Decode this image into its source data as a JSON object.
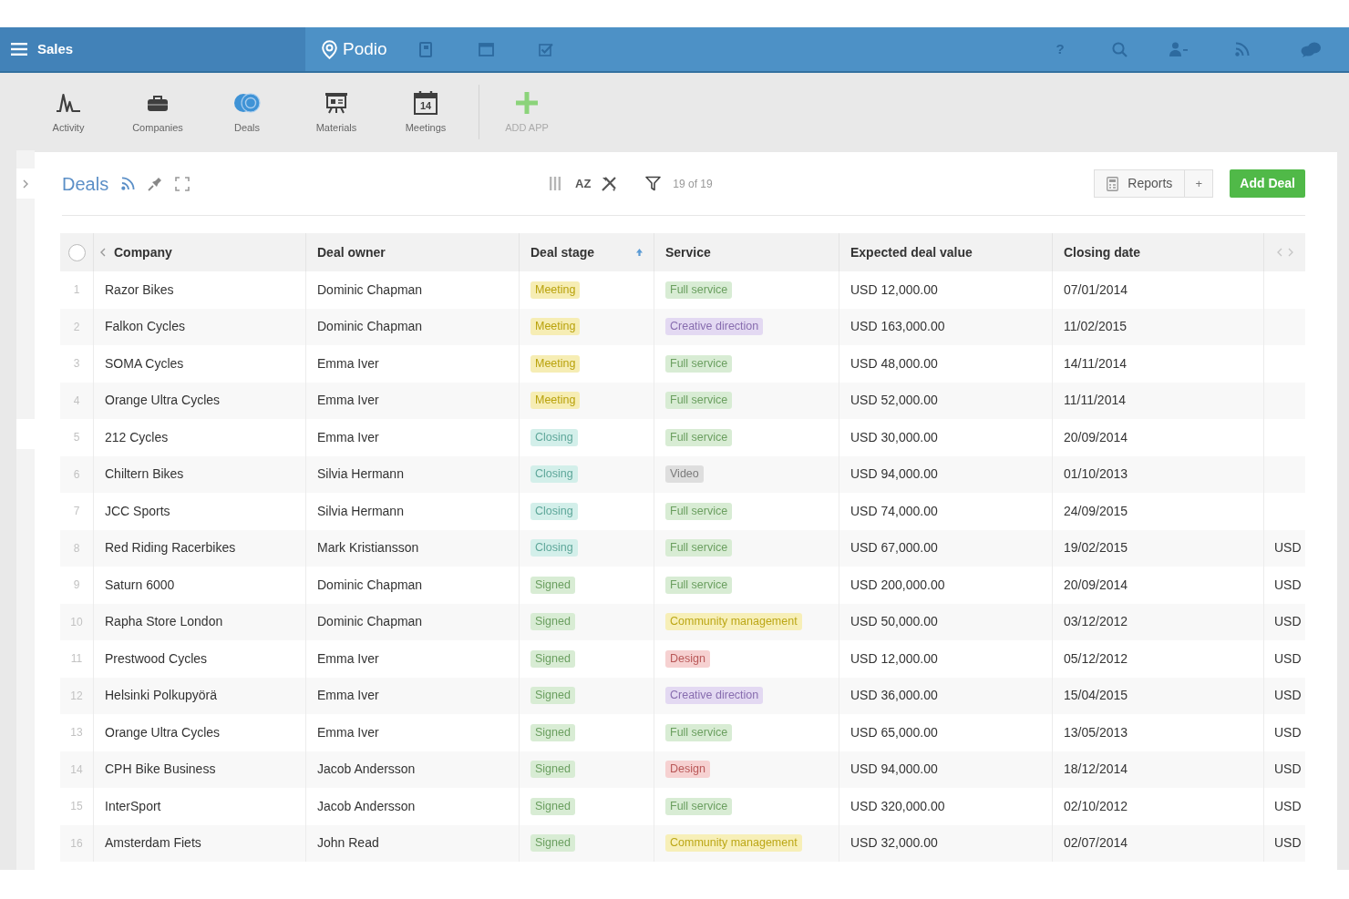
{
  "top_bar": {
    "workspace": "Sales",
    "logo_text": "Podio",
    "help_label": "?"
  },
  "apps": [
    {
      "label": "Activity",
      "kind": "activity",
      "selected": false
    },
    {
      "label": "Companies",
      "kind": "companies",
      "selected": false
    },
    {
      "label": "Deals",
      "kind": "deals",
      "selected": true
    },
    {
      "label": "Materials",
      "kind": "materials",
      "selected": false
    },
    {
      "label": "Meetings",
      "kind": "meetings",
      "selected": false,
      "icon_text": "14"
    }
  ],
  "add_app": {
    "label": "ADD APP"
  },
  "panel": {
    "title": "Deals",
    "sort_label": "AZ",
    "filter_count": "19 of 19",
    "reports_label": "Reports",
    "reports_add_label": "+",
    "add_button_label": "Add Deal"
  },
  "table": {
    "select_all": {
      "checked": false
    },
    "columns": [
      {
        "label": "Company",
        "sorted": false
      },
      {
        "label": "Deal owner",
        "sorted": false
      },
      {
        "label": "Deal stage",
        "sorted": true
      },
      {
        "label": "Service",
        "sorted": false
      },
      {
        "label": "Expected deal value",
        "sorted": false
      },
      {
        "label": "Closing date",
        "sorted": false
      }
    ],
    "rows": [
      {
        "number": "1",
        "company": "Razor Bikes",
        "owner": "Dominic Chapman",
        "stage": {
          "label": "Meeting",
          "color": "#f6edb4"
        },
        "service": {
          "label": "Full service",
          "color": "#d8ecd4"
        },
        "value": "USD 12,000.00",
        "closing_date": "07/01/2014"
      },
      {
        "number": "2",
        "company": "Falkon Cycles",
        "owner": "Dominic Chapman",
        "stage": {
          "label": "Meeting",
          "color": "#f6edb4"
        },
        "service": {
          "label": "Creative direction",
          "color": "#e3d9f2"
        },
        "value": "USD 163,000.00",
        "closing_date": "11/02/2015"
      },
      {
        "number": "3",
        "company": "SOMA Cycles",
        "owner": "Emma Iver",
        "stage": {
          "label": "Meeting",
          "color": "#f6edb4"
        },
        "service": {
          "label": "Full service",
          "color": "#d8ecd4"
        },
        "value": "USD 48,000.00",
        "closing_date": "14/11/2014"
      },
      {
        "number": "4",
        "company": "Orange Ultra Cycles",
        "owner": "Emma Iver",
        "stage": {
          "label": "Meeting",
          "color": "#f6edb4"
        },
        "service": {
          "label": "Full service",
          "color": "#d8ecd4"
        },
        "value": "USD 52,000.00",
        "closing_date": "11/11/2014"
      },
      {
        "number": "5",
        "company": "212 Cycles",
        "owner": "Emma Iver",
        "stage": {
          "label": "Closing",
          "color": "#d3efea"
        },
        "service": {
          "label": "Full service",
          "color": "#d8ecd4"
        },
        "value": "USD 30,000.00",
        "closing_date": "20/09/2014"
      },
      {
        "number": "6",
        "company": "Chiltern Bikes",
        "owner": "Silvia Hermann",
        "stage": {
          "label": "Closing",
          "color": "#d3efea"
        },
        "service": {
          "label": "Video",
          "color": "#dedede"
        },
        "value": "USD 94,000.00",
        "closing_date": "01/10/2013"
      },
      {
        "number": "7",
        "company": "JCC Sports",
        "owner": "Silvia Hermann",
        "stage": {
          "label": "Closing",
          "color": "#d3efea"
        },
        "service": {
          "label": "Full service",
          "color": "#d8ecd4"
        },
        "value": "USD 74,000.00",
        "closing_date": "24/09/2015"
      },
      {
        "number": "8",
        "company": "Red Riding Racerbikes",
        "owner": "Mark Kristiansson",
        "stage": {
          "label": "Closing",
          "color": "#d3efea"
        },
        "service": {
          "label": "Full service",
          "color": "#d8ecd4"
        },
        "value": "USD 67,000.00",
        "closing_date": "19/02/2015",
        "column_7": "USD"
      },
      {
        "number": "9",
        "company": "Saturn 6000",
        "owner": "Dominic Chapman",
        "stage": {
          "label": "Signed",
          "color": "#d8ecd4"
        },
        "service": {
          "label": "Full service",
          "color": "#d8ecd4"
        },
        "value": "USD 200,000.00",
        "closing_date": "20/09/2014",
        "column_7": "USD"
      },
      {
        "number": "10",
        "company": "Rapha Store London",
        "owner": "Dominic Chapman",
        "stage": {
          "label": "Signed",
          "color": "#d8ecd4"
        },
        "service": {
          "label": "Community management",
          "color": "#f7efb8"
        },
        "value": "USD 50,000.00",
        "closing_date": "03/12/2012",
        "column_7": "USD"
      },
      {
        "number": "11",
        "company": "Prestwood Cycles",
        "owner": "Emma Iver",
        "stage": {
          "label": "Signed",
          "color": "#d8ecd4"
        },
        "service": {
          "label": "Design",
          "color": "#f6d1d1"
        },
        "value": "USD 12,000.00",
        "closing_date": "05/12/2012",
        "column_7": "USD"
      },
      {
        "number": "12",
        "company": "Helsinki Polkupyörä",
        "owner": "Emma Iver",
        "stage": {
          "label": "Signed",
          "color": "#d8ecd4"
        },
        "service": {
          "label": "Creative direction",
          "color": "#e3d9f2"
        },
        "value": "USD 36,000.00",
        "closing_date": "15/04/2015",
        "column_7": "USD"
      },
      {
        "number": "13",
        "company": "Orange Ultra Cycles",
        "owner": "Emma Iver",
        "stage": {
          "label": "Signed",
          "color": "#d8ecd4"
        },
        "service": {
          "label": "Full service",
          "color": "#d8ecd4"
        },
        "value": "USD 65,000.00",
        "closing_date": "13/05/2013",
        "column_7": "USD"
      },
      {
        "number": "14",
        "company": "CPH Bike Business",
        "owner": "Jacob Andersson",
        "stage": {
          "label": "Signed",
          "color": "#d8ecd4"
        },
        "service": {
          "label": "Design",
          "color": "#f6d1d1"
        },
        "value": "USD 94,000.00",
        "closing_date": "18/12/2014",
        "column_7": "USD"
      },
      {
        "number": "15",
        "company": "InterSport",
        "owner": "Jacob Andersson",
        "stage": {
          "label": "Signed",
          "color": "#d8ecd4"
        },
        "service": {
          "label": "Full service",
          "color": "#d8ecd4"
        },
        "value": "USD 320,000.00",
        "closing_date": "02/10/2012",
        "column_7": "USD"
      },
      {
        "number": "16",
        "company": "Amsterdam Fiets",
        "owner": "John Read",
        "stage": {
          "label": "Signed",
          "color": "#d8ecd4"
        },
        "service": {
          "label": "Community management",
          "color": "#f7efb8"
        },
        "value": "USD 32,000.00",
        "closing_date": "02/07/2014",
        "column_7": "USD"
      }
    ]
  }
}
